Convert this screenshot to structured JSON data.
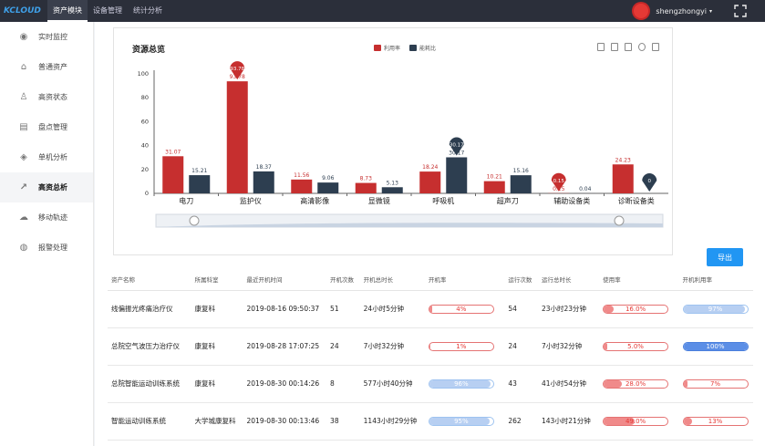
{
  "header": {
    "logo": "KCLOUD",
    "nav": [
      "资产模块",
      "设备管理",
      "统计分析"
    ],
    "username": "shengzhongyi"
  },
  "sidebar": {
    "items": [
      {
        "label": "实时监控",
        "icon": "location-icon"
      },
      {
        "label": "普通资产",
        "icon": "bank-icon"
      },
      {
        "label": "高资状态",
        "icon": "person-icon"
      },
      {
        "label": "盘点管理",
        "icon": "inventory-icon"
      },
      {
        "label": "单机分析",
        "icon": "layers-icon"
      },
      {
        "label": "高资总析",
        "icon": "line-chart-icon"
      },
      {
        "label": "移动轨迹",
        "icon": "cloud-icon"
      },
      {
        "label": "报警处理",
        "icon": "globe-icon"
      }
    ]
  },
  "chart_data": {
    "type": "bar",
    "title": "资源总览",
    "categories": [
      "电刀",
      "监护仪",
      "高清影像",
      "显微镜",
      "呼吸机",
      "超声刀",
      "辅助设备类",
      "诊断设备类"
    ],
    "series": [
      {
        "name": "利用率",
        "color": "#c62f2f",
        "values": [
          31.07,
          93.78,
          11.56,
          8.73,
          18.24,
          10.21,
          0.15,
          24.23
        ]
      },
      {
        "name": "能耗比",
        "color": "#2d3e50",
        "values": [
          15.21,
          18.37,
          9.06,
          5.13,
          30.17,
          15.16,
          0.04,
          0
        ]
      }
    ],
    "markers": [
      {
        "label": "93.78"
      },
      {
        "label": "30.17"
      },
      {
        "label": "0.15"
      },
      {
        "label": "0"
      }
    ],
    "y_ticks": [
      "0",
      "20",
      "40",
      "60",
      "80",
      "100"
    ],
    "ylim": [
      0,
      100
    ]
  },
  "export_label": "导出",
  "table": {
    "headers": [
      "资产名称",
      "所属科室",
      "最近开机时间",
      "开机次数",
      "开机总时长",
      "开机率",
      "运行次数",
      "运行总时长",
      "使用率",
      "开机利用率"
    ],
    "rows": [
      {
        "name": "线偏振光疼痛治疗仪",
        "dept": "康复科",
        "time": "2019-08-16 09:50:37",
        "on_count": "51",
        "on_total": "24小时5分钟",
        "on_rate": "4%",
        "on_rate_v": 4,
        "run_count": "54",
        "run_total": "23小时23分钟",
        "use_rate": "16.0%",
        "use_rate_v": 16,
        "on_use_rate": "97%",
        "on_use_rate_v": 97
      },
      {
        "name": "总院空气波压力治疗仪",
        "dept": "康复科",
        "time": "2019-08-28 17:07:25",
        "on_count": "24",
        "on_total": "7小时32分钟",
        "on_rate": "1%",
        "on_rate_v": 1,
        "run_count": "24",
        "run_total": "7小时32分钟",
        "use_rate": "5.0%",
        "use_rate_v": 5,
        "on_use_rate": "100%",
        "on_use_rate_v": 100
      },
      {
        "name": "总院智能运动训练系统",
        "dept": "康复科",
        "time": "2019-08-30 00:14:26",
        "on_count": "8",
        "on_total": "577小时40分钟",
        "on_rate": "96%",
        "on_rate_v": 96,
        "run_count": "43",
        "run_total": "41小时54分钟",
        "use_rate": "28.0%",
        "use_rate_v": 28,
        "on_use_rate": "7%",
        "on_use_rate_v": 7
      },
      {
        "name": "智能运动训练系统",
        "dept": "大学城康复科",
        "time": "2019-08-30 00:13:46",
        "on_count": "38",
        "on_total": "1143小时29分钟",
        "on_rate": "95%",
        "on_rate_v": 95,
        "run_count": "262",
        "run_total": "143小时21分钟",
        "use_rate": "49.0%",
        "use_rate_v": 49,
        "on_use_rate": "13%",
        "on_use_rate_v": 13
      }
    ]
  }
}
